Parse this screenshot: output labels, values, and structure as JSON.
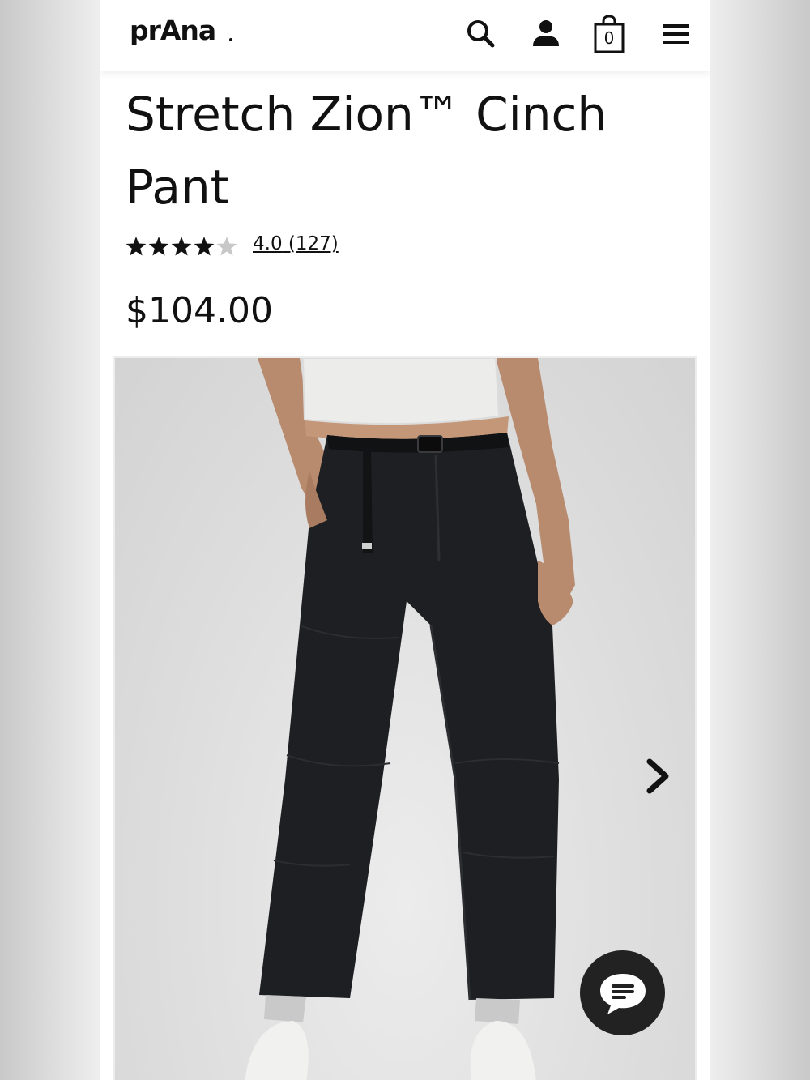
{
  "header": {
    "logo": "prAna",
    "bag_count": "0",
    "icons": [
      "search-icon",
      "account-icon",
      "shopping-bag-icon",
      "menu-icon"
    ]
  },
  "product": {
    "title": "Stretch Zion™ Cinch Pant",
    "rating_value": "4.0",
    "review_count": "(127)",
    "rating": 4.0,
    "rating_max": 5,
    "price": "$104.00"
  },
  "gallery": {
    "next_icon": "chevron-right-icon"
  },
  "chat": {
    "icon": "chat-icon"
  },
  "colors": {
    "text": "#111111",
    "star_filled": "#111111",
    "star_empty": "#c8c8c8",
    "chat_button": "#222222"
  }
}
